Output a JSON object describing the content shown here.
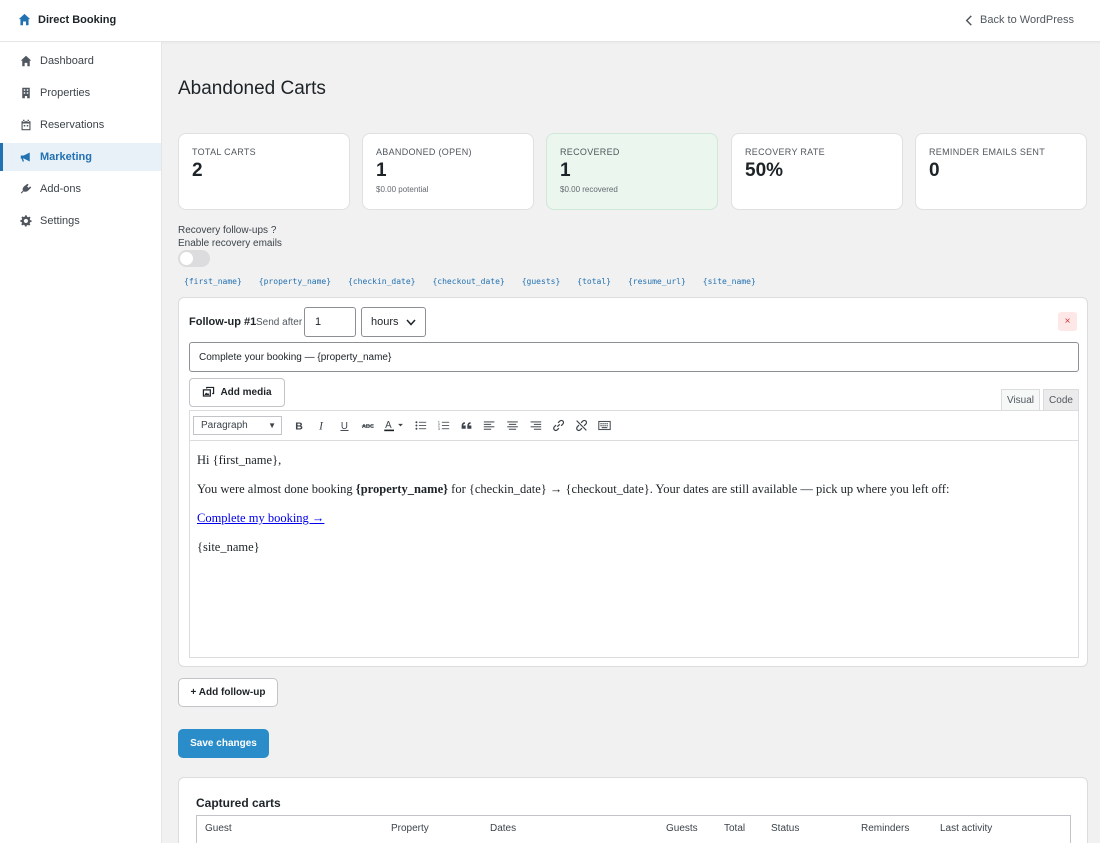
{
  "app": {
    "title": "Direct Booking",
    "back_link": "Back to WordPress"
  },
  "sidebar": {
    "items": [
      {
        "label": "Dashboard",
        "icon": "home-icon"
      },
      {
        "label": "Properties",
        "icon": "building-icon"
      },
      {
        "label": "Reservations",
        "icon": "calendar-icon"
      },
      {
        "label": "Marketing",
        "icon": "megaphone-icon",
        "active": true
      },
      {
        "label": "Add-ons",
        "icon": "plugin-icon"
      },
      {
        "label": "Settings",
        "icon": "gear-icon"
      }
    ]
  },
  "page": {
    "title": "Abandoned Carts"
  },
  "stats": [
    {
      "label": "TOTAL CARTS",
      "value": "2",
      "sub": ""
    },
    {
      "label": "ABANDONED (OPEN)",
      "value": "1",
      "sub": "$0.00 potential"
    },
    {
      "label": "RECOVERED",
      "value": "1",
      "sub": "$0.00 recovered"
    },
    {
      "label": "RECOVERY RATE",
      "value": "50%",
      "sub": ""
    },
    {
      "label": "REMINDER EMAILS SENT",
      "value": "0",
      "sub": ""
    }
  ],
  "followups": {
    "title": "Recovery follow-ups ?",
    "enable_label": "Enable recovery emails",
    "enabled": false,
    "tokens": [
      "{first_name}",
      "{property_name}",
      "{checkin_date}",
      "{checkout_date}",
      "{guests}",
      "{total}",
      "{resume_url}",
      "{site_name}"
    ]
  },
  "followup": {
    "title": "Follow-up #1",
    "send_after_label": "Send after",
    "delay_value": "1",
    "delay_unit": "hours",
    "remove_label": "×",
    "subject": "Complete your booking — {property_name}",
    "add_media_label": "Add media",
    "tab_visual": "Visual",
    "tab_code": "Code",
    "format": "Paragraph",
    "body": {
      "greeting": "Hi {first_name},",
      "line_start": "You were almost done booking ",
      "property": "{property_name}",
      "line_end": " for {checkin_date} → {checkout_date}. Your dates are still available — pick up where you left off:",
      "link": "Complete my booking →",
      "signoff": "{site_name}"
    }
  },
  "buttons": {
    "add_followup": "+ Add follow-up",
    "save": "Save changes"
  },
  "carts": {
    "title": "Captured carts",
    "columns": [
      "Guest",
      "Property",
      "Dates",
      "Guests",
      "Total",
      "Status",
      "Reminders",
      "Last activity"
    ]
  },
  "colors": {
    "accent": "#2271b1",
    "save_button": "#2a8cc8",
    "recovered_card": "#eaf6ee"
  }
}
